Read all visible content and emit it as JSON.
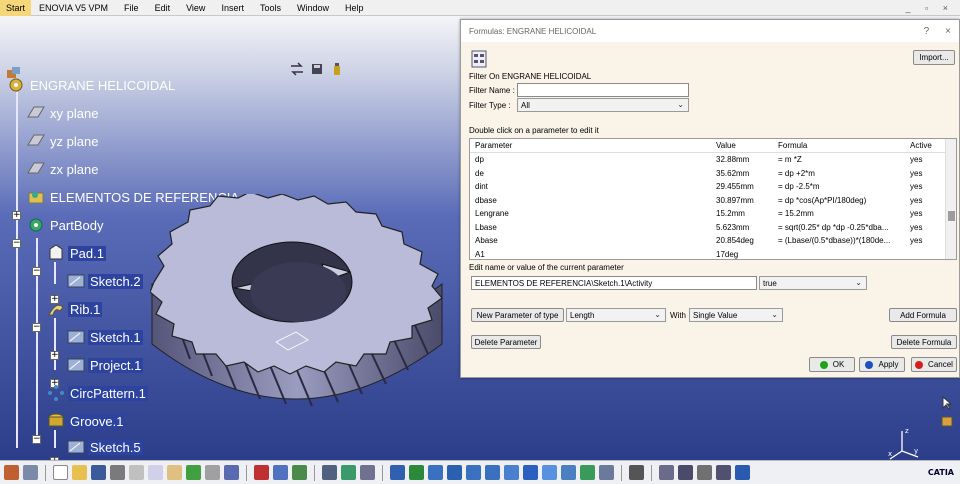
{
  "menubar": {
    "start": "Start",
    "app": "ENOVIA V5 VPM",
    "items": [
      "File",
      "Edit",
      "View",
      "Insert",
      "Tools",
      "Window",
      "Help"
    ],
    "window_controls": "_ ▫ ×"
  },
  "tree": {
    "root": "ENGRANE HELICOIDAL",
    "nodes": [
      {
        "label": "xy plane"
      },
      {
        "label": "yz plane"
      },
      {
        "label": "zx plane"
      },
      {
        "label": "ELEMENTOS DE REFERENCIA"
      },
      {
        "label": "PartBody"
      },
      {
        "label": "Pad.1"
      },
      {
        "label": "Sketch.2"
      },
      {
        "label": "Rib.1"
      },
      {
        "label": "Sketch.1"
      },
      {
        "label": "Project.1"
      },
      {
        "label": "CircPattern.1"
      },
      {
        "label": "Groove.1"
      },
      {
        "label": "Sketch.5"
      }
    ]
  },
  "dialog": {
    "title": "Formulas: ENGRANE HELICOIDAL",
    "help": "?",
    "close": "×",
    "import_label": "Import...",
    "filter_on": "Filter On ENGRANE HELICOIDAL",
    "filter_name_label": "Filter Name :",
    "filter_name_value": "",
    "filter_type_label": "Filter Type :",
    "filter_type_value": "All",
    "instruction": "Double click on a parameter to edit it",
    "columns": [
      "Parameter",
      "Value",
      "Formula",
      "Active"
    ],
    "rows": [
      {
        "param": "dp",
        "value": "32.88mm",
        "formula": "= m *Z",
        "active": "yes"
      },
      {
        "param": "de",
        "value": "35.62mm",
        "formula": "= dp +2*m",
        "active": "yes"
      },
      {
        "param": "dint",
        "value": "29.455mm",
        "formula": "= dp -2.5*m",
        "active": "yes"
      },
      {
        "param": "dbase",
        "value": "30.897mm",
        "formula": "= dp *cos(Ap*PI/180deg)",
        "active": "yes"
      },
      {
        "param": "Lengrane",
        "value": "15.2mm",
        "formula": "= 15.2mm",
        "active": "yes"
      },
      {
        "param": "Lbase",
        "value": "5.623mm",
        "formula": "= sqrt(0.25* dp *dp -0.25*dba...",
        "active": "yes"
      },
      {
        "param": "Abase",
        "value": "20.854deg",
        "formula": "= (Lbase/(0.5*dbase))*(180de...",
        "active": "yes"
      },
      {
        "param": "A1",
        "value": "17deg",
        "formula": "",
        "active": ""
      }
    ],
    "edit_label": "Edit name or value of the current parameter",
    "edit_value": "ELEMENTOS DE REFERENCIA\\Sketch.1\\Activity",
    "edit_select": "true",
    "new_param_label": "New Parameter of type",
    "param_type": "Length",
    "with_label": "With",
    "with_value": "Single Value",
    "add_formula": "Add Formula",
    "delete_parameter": "Delete Parameter",
    "delete_formula": "Delete Formula",
    "ok": "OK",
    "apply": "Apply",
    "cancel": "Cancel"
  },
  "toolbar": {
    "catia": "CATIA"
  },
  "colors": {
    "selection": "#2d43a0",
    "ok_dot": "#1ea31e",
    "apply_dot": "#1d4fbf",
    "cancel_dot": "#d11f1f",
    "gear": "#b9bbd8"
  }
}
